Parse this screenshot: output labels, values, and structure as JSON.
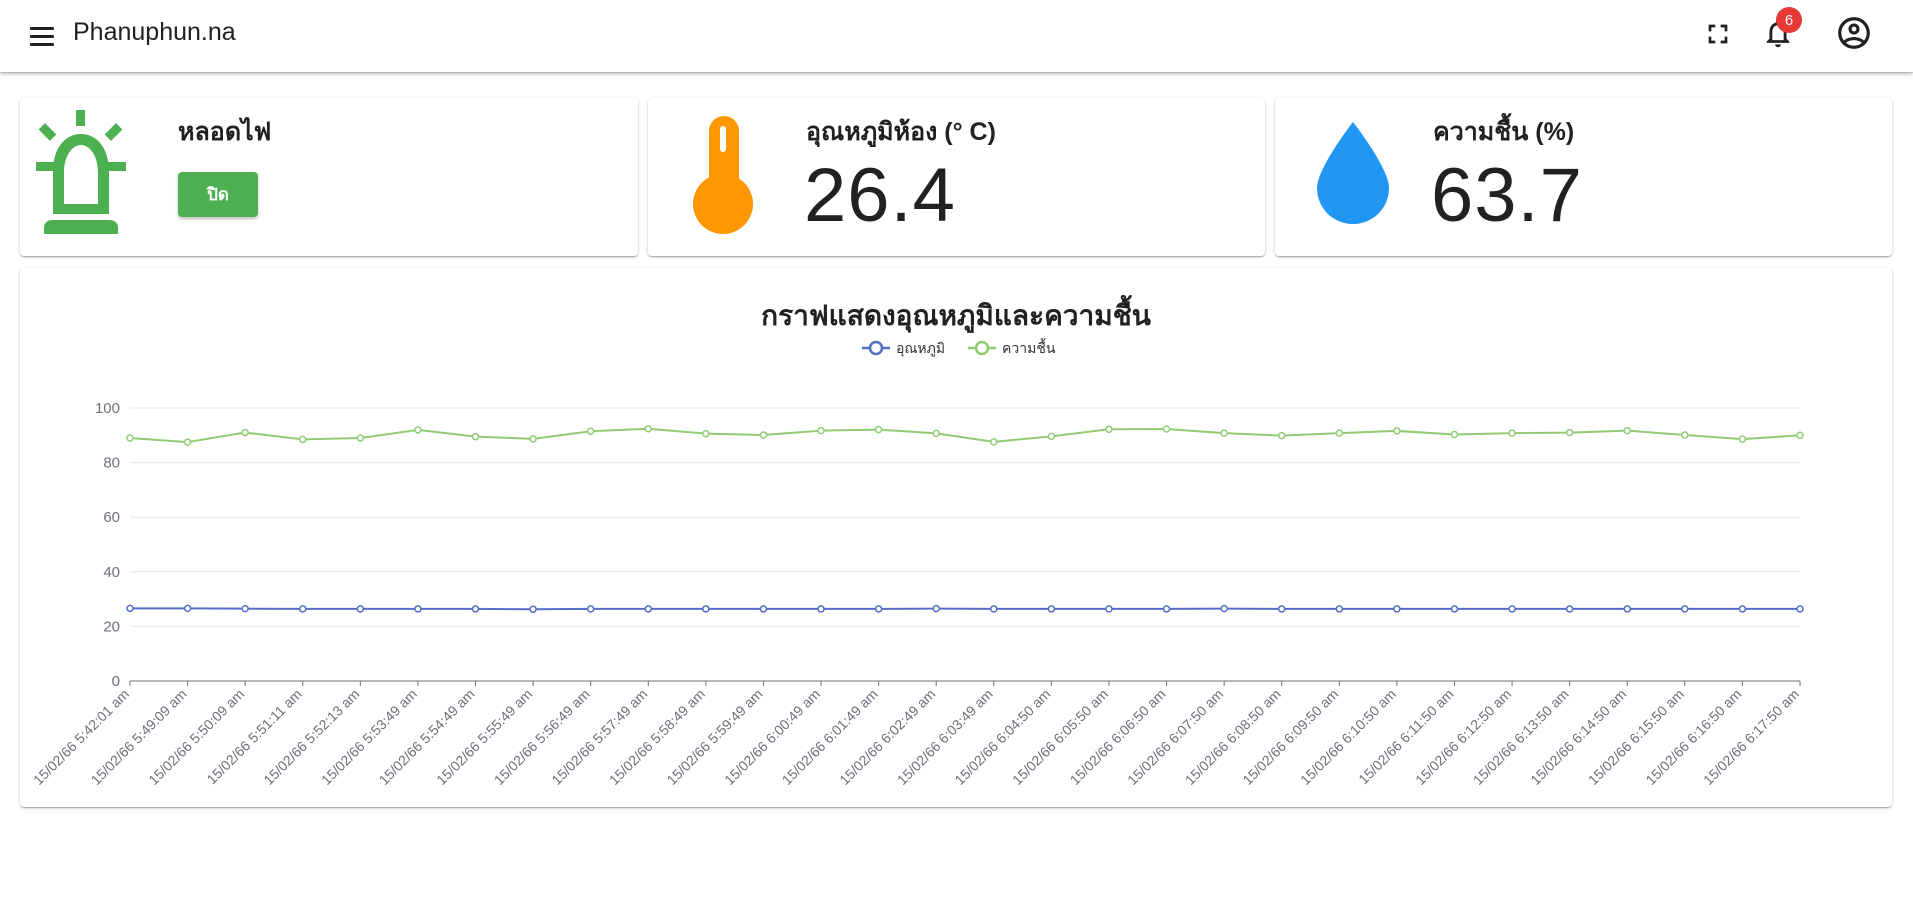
{
  "header": {
    "title": "Phanuphun.na",
    "notification_count": "6",
    "icons": {
      "menu": "menu-icon",
      "fullscreen": "fullscreen-icon",
      "notifications": "bell-icon",
      "account": "account-circle-icon"
    }
  },
  "cards": {
    "lamp": {
      "title": "หลอดไฟ",
      "button_label": "ปิด",
      "icon": "alarm-light-icon",
      "color": "#4caf50"
    },
    "temperature": {
      "title": "อุณหภูมิห้อง (° C)",
      "value": "26.4",
      "icon": "thermometer-icon",
      "color": "#ff9800"
    },
    "humidity": {
      "title": "ความชื้น (%)",
      "value": "63.7",
      "icon": "water-drop-icon",
      "color": "#2196f3"
    }
  },
  "chart_data": {
    "type": "line",
    "title": "กราฟแสดงอุณหภูมิและความชื้น",
    "legend_position": "top-center",
    "grid": true,
    "ylim": [
      0,
      100
    ],
    "yticks": [
      0,
      20,
      40,
      60,
      80,
      100
    ],
    "x": [
      "15/02/66 5:42:01 am",
      "15/02/66 5:49:09 am",
      "15/02/66 5:50:09 am",
      "15/02/66 5:51:11 am",
      "15/02/66 5:52:13 am",
      "15/02/66 5:53:49 am",
      "15/02/66 5:54:49 am",
      "15/02/66 5:55:49 am",
      "15/02/66 5:56:49 am",
      "15/02/66 5:57:49 am",
      "15/02/66 5:58:49 am",
      "15/02/66 5:59:49 am",
      "15/02/66 6:00:49 am",
      "15/02/66 6:01:49 am",
      "15/02/66 6:02:49 am",
      "15/02/66 6:03:49 am",
      "15/02/66 6:04:50 am",
      "15/02/66 6:05:50 am",
      "15/02/66 6:06:50 am",
      "15/02/66 6:07:50 am",
      "15/02/66 6:08:50 am",
      "15/02/66 6:09:50 am",
      "15/02/66 6:10:50 am",
      "15/02/66 6:11:50 am",
      "15/02/66 6:12:50 am",
      "15/02/66 6:13:50 am",
      "15/02/66 6:14:50 am",
      "15/02/66 6:15:50 am",
      "15/02/66 6:16:50 am",
      "15/02/66 6:17:50 am"
    ],
    "series": [
      {
        "name": "อุณหภูมิ",
        "color": "#5470c6",
        "values": [
          26.6,
          26.6,
          26.5,
          26.4,
          26.4,
          26.4,
          26.4,
          26.3,
          26.4,
          26.4,
          26.4,
          26.4,
          26.4,
          26.4,
          26.5,
          26.4,
          26.4,
          26.4,
          26.4,
          26.5,
          26.4,
          26.4,
          26.4,
          26.4,
          26.4,
          26.4,
          26.4,
          26.4,
          26.4,
          26.4
        ]
      },
      {
        "name": "ความชื้น",
        "color": "#91cc75",
        "values": [
          89.0,
          87.5,
          91.0,
          88.5,
          89.0,
          92.0,
          89.5,
          88.7,
          91.5,
          92.4,
          90.6,
          90.1,
          91.7,
          92.1,
          90.7,
          87.6,
          89.6,
          92.2,
          92.3,
          90.8,
          89.9,
          90.8,
          91.6,
          90.3,
          90.8,
          91.0,
          91.7,
          90.1,
          88.6,
          90.0
        ]
      }
    ]
  }
}
